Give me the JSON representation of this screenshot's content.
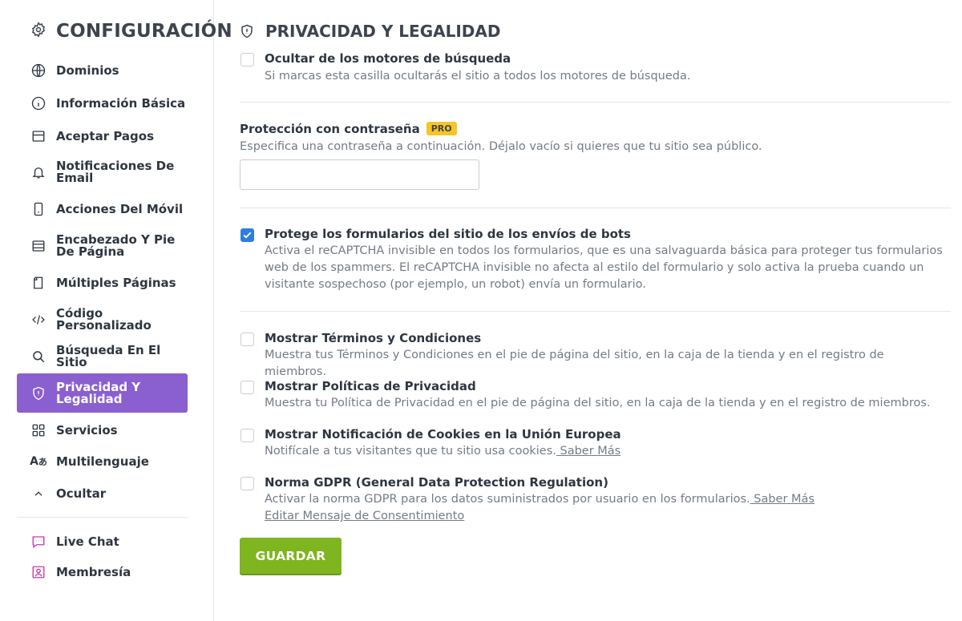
{
  "sidebar": {
    "title": "CONFIGURACIÓN",
    "items": [
      {
        "label": "Dominios",
        "icon": "globe-icon"
      },
      {
        "label": "Información Básica",
        "icon": "info-icon"
      },
      {
        "label": "Aceptar Pagos",
        "icon": "credit-card-icon"
      },
      {
        "label": "Notificaciones De Email",
        "line1": "Notificaciones De",
        "line2": "Email",
        "icon": "bell-icon"
      },
      {
        "label": "Acciones Del Móvil",
        "icon": "mobile-icon"
      },
      {
        "label": "Encabezado Y Pie De Página",
        "line1": "Encabezado Y Pie",
        "line2": "De Página",
        "icon": "layout-icon"
      },
      {
        "label": "Múltiples Páginas",
        "icon": "pages-icon"
      },
      {
        "label": "Código Personalizado",
        "line1": "Código",
        "line2": "Personalizado",
        "icon": "code-icon"
      },
      {
        "label": "Búsqueda En El Sitio",
        "icon": "search-icon"
      },
      {
        "label": "Privacidad Y Legalidad",
        "line1": "Privacidad Y",
        "line2": "Legalidad",
        "icon": "shield-icon",
        "active": true
      },
      {
        "label": "Servicios",
        "icon": "grid-icon"
      },
      {
        "label": "Multilenguaje",
        "icon": "translate-icon"
      },
      {
        "label": "Ocultar",
        "icon": "chevron-up-icon"
      }
    ],
    "extras": [
      {
        "label": "Live Chat",
        "icon": "chat-icon"
      },
      {
        "label": "Membresía",
        "icon": "member-icon"
      }
    ],
    "active_color": "#8a5fd0",
    "extras_icon_color": "#c33aa6"
  },
  "main": {
    "title": "PRIVACIDAD Y LEGALIDAD",
    "hide_search": {
      "title": "Ocultar de los motores de búsqueda",
      "desc": "Si marcas esta casilla ocultarás el sitio a todos los motores de búsqueda.",
      "checked": false
    },
    "password": {
      "title": "Protección con contraseña",
      "badge": "PRO",
      "desc": "Especifica una contraseña a continuación. Déjalo vacío si quieres que tu sitio sea público.",
      "value": ""
    },
    "recaptcha": {
      "title": "Protege los formularios del sitio de los envíos de bots",
      "desc": "Activa el reCAPTCHA invisible en todos los formularios, que es una salvaguarda básica para proteger tus formularios web de los spammers. El reCAPTCHA invisible no afecta al estilo del formulario y solo activa la prueba cuando un visitante sospechoso (por ejemplo, un robot) envía un formulario.",
      "checked": true
    },
    "terms": {
      "title": "Mostrar Términos y Condiciones",
      "desc": "Muestra tus Términos y Condiciones en el pie de página del sitio, en la caja de la tienda y en el registro de miembros.",
      "checked": false
    },
    "privacy": {
      "title": "Mostrar Políticas de Privacidad",
      "desc": "Muestra tu Política de Privacidad en el pie de página del sitio, en la caja de la tienda y en el registro de miembros.",
      "checked": false
    },
    "cookies": {
      "title": "Mostrar Notificación de Cookies en la Unión Europea",
      "desc": "Notifícale a tus visitantes que tu sitio usa cookies.",
      "link": " Saber Más",
      "checked": false
    },
    "gdpr": {
      "title": "Norma GDPR (General Data Protection Regulation)",
      "desc": "Activar la norma GDPR para los datos suministrados por usuario en los formularios.",
      "link": " Saber Más",
      "link2": "Editar Mensaje de Consentimiento",
      "checked": false
    },
    "save_label": "GUARDAR",
    "save_color": "#7fb51f",
    "checkbox_color": "#2f7de1"
  }
}
